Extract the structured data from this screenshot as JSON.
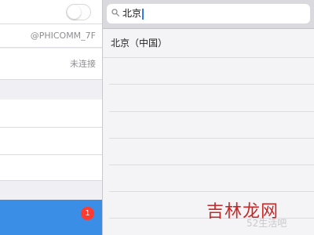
{
  "settings": {
    "wifi_name": "@PHICOMM_7F",
    "connection_status": "未连接",
    "badge_count": "1",
    "toggle_on": false
  },
  "search": {
    "query": "北京",
    "results": [
      "北京（中国）"
    ]
  },
  "colors": {
    "accent_blue": "#3a8ee6",
    "badge_red": "#ff3b30",
    "caret_blue": "#2f7bf5"
  },
  "watermark": {
    "brand": "吉林龙网",
    "sub": "52生活吧"
  }
}
